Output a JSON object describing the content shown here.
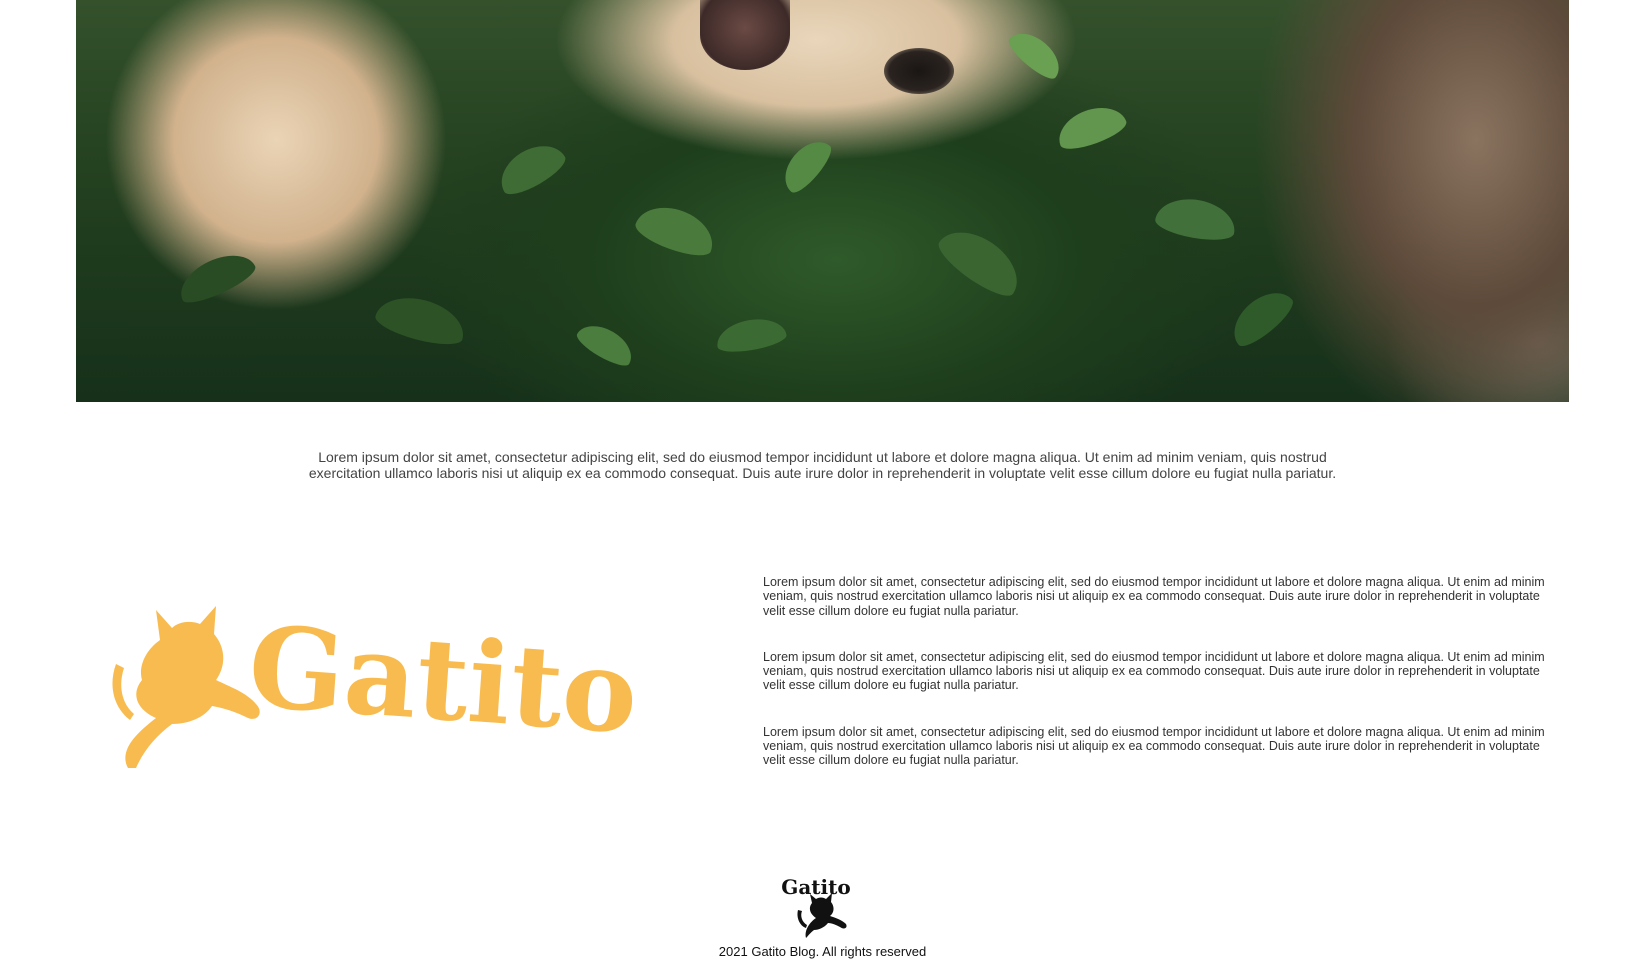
{
  "hero": {
    "image_alt_semantic": "dog-and-cat-in-leaves-photo"
  },
  "intro": {
    "text": "Lorem ipsum dolor sit amet, consectetur adipiscing elit, sed do eiusmod tempor incididunt ut labore et dolore magna aliqua. Ut enim ad minim veniam, quis nostrud exercitation ullamco laboris nisi ut aliquip ex ea commodo consequat. Duis aute irure dolor in reprehenderit in voluptate velit esse cillum dolore eu fugiat nulla pariatur."
  },
  "brand": {
    "logo_text": "Gatito",
    "logo_color": "#F8BB4F"
  },
  "paragraphs": [
    "Lorem ipsum dolor sit amet, consectetur adipiscing elit, sed do eiusmod tempor incididunt ut labore et dolore magna aliqua. Ut enim ad minim veniam, quis nostrud exercitation ullamco laboris nisi ut aliquip ex ea commodo consequat. Duis aute irure dolor in reprehenderit in voluptate velit esse cillum dolore eu fugiat nulla pariatur.",
    "Lorem ipsum dolor sit amet, consectetur adipiscing elit, sed do eiusmod tempor incididunt ut labore et dolore magna aliqua. Ut enim ad minim veniam, quis nostrud exercitation ullamco laboris nisi ut aliquip ex ea commodo consequat. Duis aute irure dolor in reprehenderit in voluptate velit esse cillum dolore eu fugiat nulla pariatur.",
    "Lorem ipsum dolor sit amet, consectetur adipiscing elit, sed do eiusmod tempor incididunt ut labore et dolore magna aliqua. Ut enim ad minim veniam, quis nostrud exercitation ullamco laboris nisi ut aliquip ex ea commodo consequat. Duis aute irure dolor in reprehenderit in voluptate velit esse cillum dolore eu fugiat nulla pariatur."
  ],
  "footer": {
    "logo_text": "Gatito",
    "copyright": "2021 Gatito Blog. All rights reserved"
  }
}
